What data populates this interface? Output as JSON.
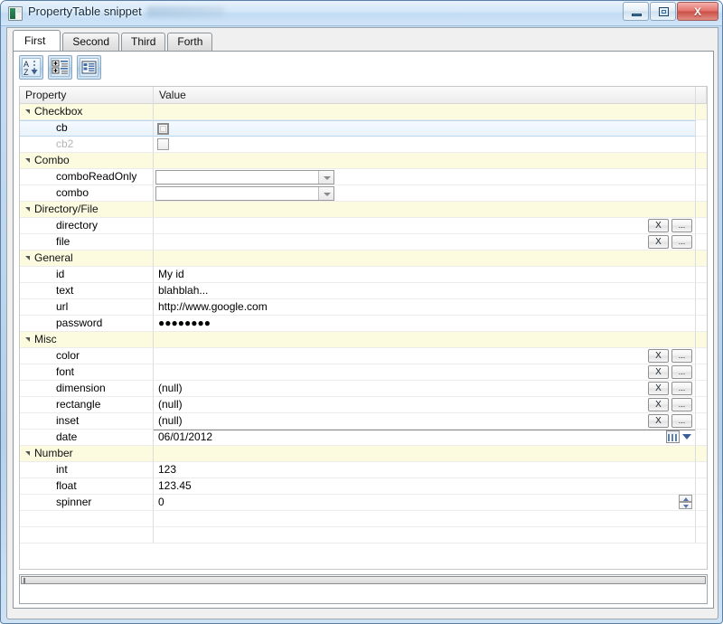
{
  "window": {
    "title": "PropertyTable snippet",
    "icon": "app-icon",
    "buttons": {
      "minimize": "minimize-button",
      "maximize": "maximize-button",
      "close_label": "X"
    }
  },
  "tabs": [
    {
      "label": "First",
      "active": true
    },
    {
      "label": "Second",
      "active": false
    },
    {
      "label": "Third",
      "active": false
    },
    {
      "label": "Forth",
      "active": false
    }
  ],
  "toolbar": {
    "buttons": [
      {
        "name": "sort-alphabetical-button",
        "icon": "sort-az-icon"
      },
      {
        "name": "expand-collapse-button",
        "icon": "tree-expand-icon"
      },
      {
        "name": "flat-list-view-button",
        "icon": "list-view-icon"
      }
    ]
  },
  "table": {
    "columns": [
      "Property",
      "Value"
    ],
    "rows": [
      {
        "kind": "category",
        "property": "Checkbox",
        "value": "",
        "widget": "none"
      },
      {
        "kind": "child",
        "property": "cb",
        "value": "",
        "widget": "checkbox-focused",
        "selected": true
      },
      {
        "kind": "child",
        "property": "cb2",
        "value": "",
        "widget": "checkbox",
        "disabled": true
      },
      {
        "kind": "category",
        "property": "Combo",
        "value": "",
        "widget": "none"
      },
      {
        "kind": "child",
        "property": "comboReadOnly",
        "value": "",
        "widget": "combo"
      },
      {
        "kind": "child",
        "property": "combo",
        "value": "",
        "widget": "combo"
      },
      {
        "kind": "category",
        "property": "Directory/File",
        "value": "",
        "widget": "none"
      },
      {
        "kind": "child",
        "property": "directory",
        "value": "",
        "widget": "clear-browse"
      },
      {
        "kind": "child",
        "property": "file",
        "value": "",
        "widget": "clear-browse"
      },
      {
        "kind": "category",
        "property": "General",
        "value": "",
        "widget": "none"
      },
      {
        "kind": "child",
        "property": "id",
        "value": "My id",
        "widget": "text"
      },
      {
        "kind": "child",
        "property": "text",
        "value": "blahblah...",
        "widget": "text"
      },
      {
        "kind": "child",
        "property": "url",
        "value": "http://www.google.com",
        "widget": "text"
      },
      {
        "kind": "child",
        "property": "password",
        "value": "●●●●●●●●",
        "widget": "text"
      },
      {
        "kind": "category",
        "property": "Misc",
        "value": "",
        "widget": "none"
      },
      {
        "kind": "child",
        "property": "color",
        "value": "",
        "widget": "clear-browse"
      },
      {
        "kind": "child",
        "property": "font",
        "value": "",
        "widget": "clear-browse"
      },
      {
        "kind": "child",
        "property": "dimension",
        "value": "(null)",
        "widget": "clear-browse"
      },
      {
        "kind": "child",
        "property": "rectangle",
        "value": "(null)",
        "widget": "clear-browse"
      },
      {
        "kind": "child",
        "property": "inset",
        "value": "(null)",
        "widget": "clear-browse"
      },
      {
        "kind": "child",
        "property": "date",
        "value": "06/01/2012",
        "widget": "datepicker"
      },
      {
        "kind": "category",
        "property": "Number",
        "value": "",
        "widget": "none"
      },
      {
        "kind": "child",
        "property": "int",
        "value": "123",
        "widget": "text"
      },
      {
        "kind": "child",
        "property": "float",
        "value": "123.45",
        "widget": "text"
      },
      {
        "kind": "child",
        "property": "spinner",
        "value": "0",
        "widget": "spinner"
      },
      {
        "kind": "blank",
        "property": "",
        "value": "",
        "widget": "none"
      },
      {
        "kind": "blank",
        "property": "",
        "value": "",
        "widget": "none"
      }
    ],
    "row_buttons": {
      "clear_label": "X",
      "browse_label": "..."
    }
  },
  "description_panel": {
    "text": ""
  },
  "colors": {
    "category_row": "#fcfbe0",
    "selected_row": "#e8f3fc",
    "disabled_text": "#b4b4b4",
    "window_frame": "#bed6ee"
  }
}
